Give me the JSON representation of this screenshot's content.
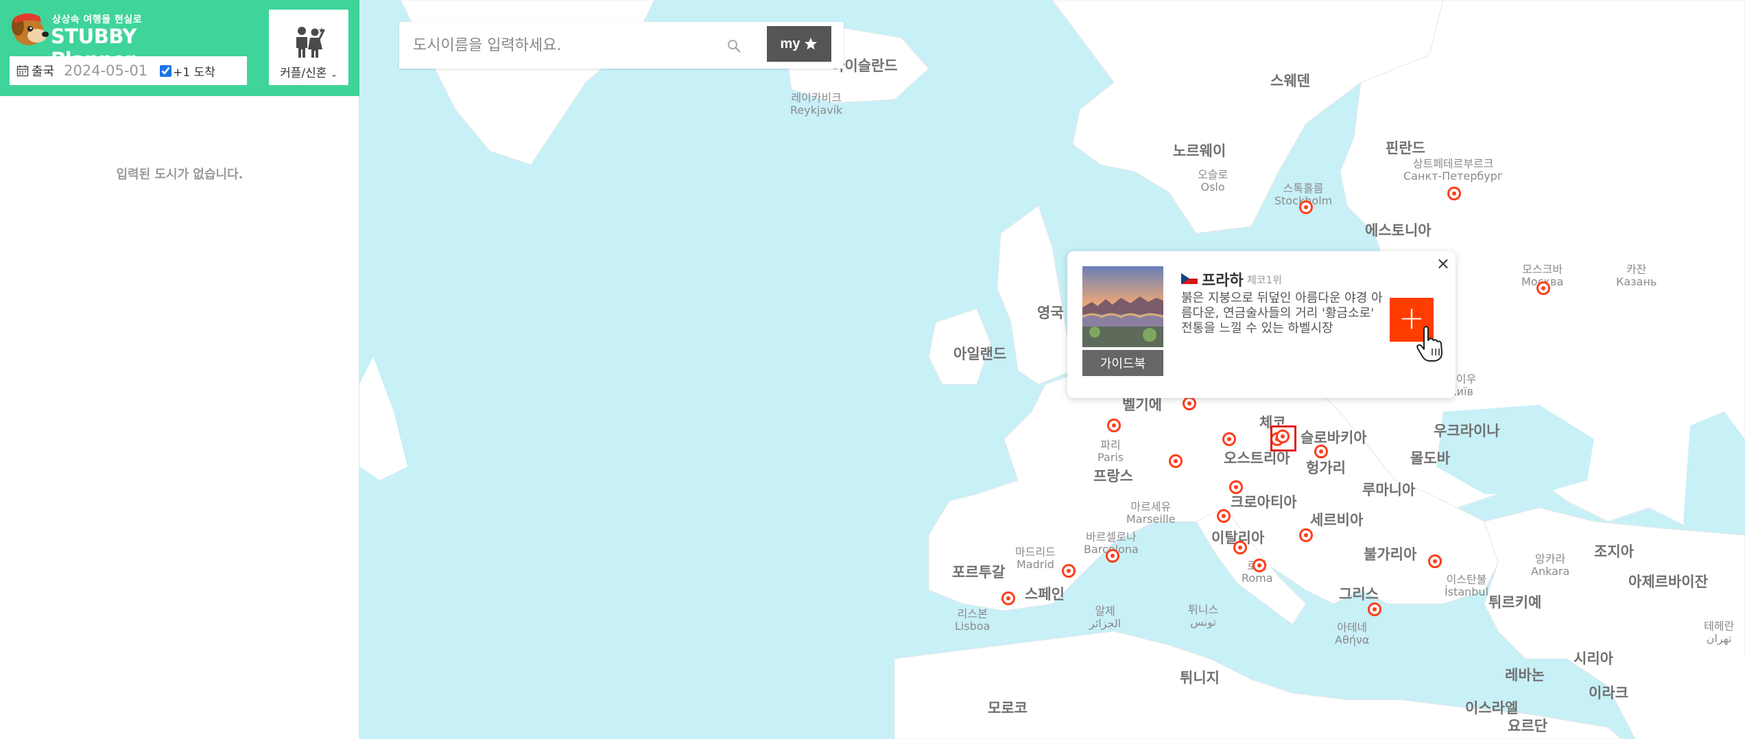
{
  "app": {
    "tagline": "상상속 여행을 현실로",
    "title": "STUBBY Planner"
  },
  "trip": {
    "depart_label": "출국",
    "depart_date": "2024-05-01",
    "arrive_label": "+1 도착",
    "arrive_checked": true,
    "type_label": "커플/신혼",
    "type_icon": "couple-icon"
  },
  "sidebar": {
    "empty_message": "입력된 도시가 없습니다."
  },
  "search": {
    "placeholder": "도시이름을 입력하세요.",
    "my_label": "my"
  },
  "popup": {
    "flag": "czech-flag",
    "city": "프라하",
    "rank": "체코1위",
    "description": "붉은 지붕으로 뒤덮인 아름다운 야경 아름다운, 연금술사들의 거리 '황금소로' 전통을 느낄 수 있는 하벨시장",
    "guide_label": "가이드북",
    "add_label": "+",
    "close_label": "×"
  },
  "map": {
    "colors": {
      "water": "#c8f0f7",
      "land": "#ffffff",
      "border": "#d9d9d9",
      "marker": "#ff3d1a"
    },
    "countries": [
      "아이슬란드",
      "스웨덴",
      "노르웨이",
      "핀란드",
      "에스토니아",
      "영국",
      "아일랜드",
      "벨기에",
      "체코",
      "슬로바키아",
      "오스트리아",
      "헝가리",
      "프랑스",
      "크로아티아",
      "루마니아",
      "몰도바",
      "우크라이나",
      "세르비아",
      "이탈리아",
      "불가리아",
      "포르투갈",
      "스페인",
      "그리스",
      "튀르키예",
      "아제르바이잔",
      "조지아",
      "시리아",
      "레바논",
      "이라크",
      "이스라엘",
      "요르단",
      "튀니지",
      "모로코"
    ],
    "cities": [
      {
        "ko": "레이카비크",
        "en": "Reykjavík"
      },
      {
        "ko": "오슬로",
        "en": "Oslo"
      },
      {
        "ko": "스톡홀름",
        "en": "Stockholm"
      },
      {
        "ko": "상트페테르부르크",
        "en": "Санкт-Петербург"
      },
      {
        "ko": "모스크바",
        "en": "Москва"
      },
      {
        "ko": "카잔",
        "en": "Казань"
      },
      {
        "ko": "키이우",
        "en": "Київ"
      },
      {
        "ko": "파리",
        "en": "Paris"
      },
      {
        "ko": "마르세유",
        "en": "Marseille"
      },
      {
        "ko": "바르셀로나",
        "en": "Barcelona"
      },
      {
        "ko": "마드리드",
        "en": "Madrid"
      },
      {
        "ko": "리스본",
        "en": "Lisboa"
      },
      {
        "ko": "알제",
        "en": "الجزائر"
      },
      {
        "ko": "튀니스",
        "en": "تونس"
      },
      {
        "ko": "로마",
        "en": "Roma"
      },
      {
        "ko": "앙카라",
        "en": "Ankara"
      },
      {
        "ko": "이스탄불",
        "en": "İstanbul"
      },
      {
        "ko": "아테네",
        "en": "Αθήνα"
      },
      {
        "ko": "테헤란",
        "en": "تهران"
      }
    ]
  }
}
